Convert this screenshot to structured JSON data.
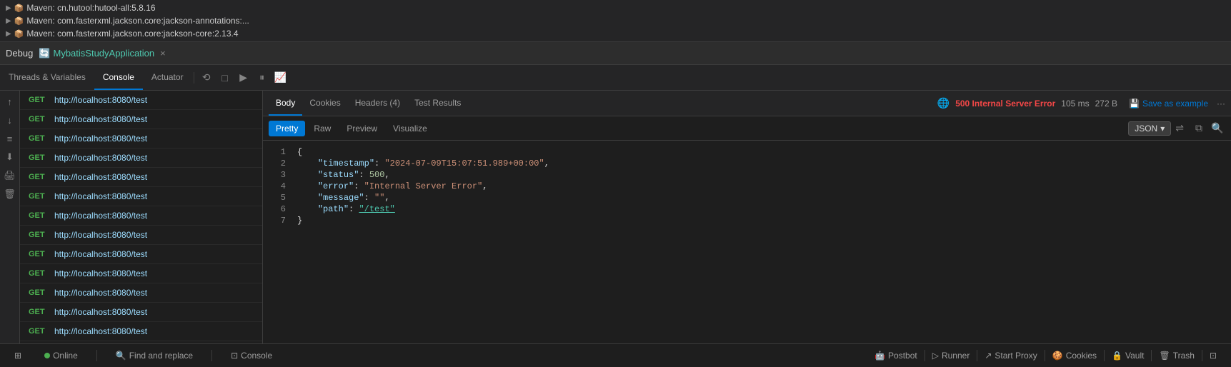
{
  "maven": {
    "items": [
      {
        "label": "Maven: cn.hutool:hutool-all:5.8.16",
        "indent": 1
      },
      {
        "label": "Maven: com.fasterxml.jackson.core:jackson-annotations:...",
        "indent": 1
      },
      {
        "label": "Maven: com.fasterxml.jackson.core:jackson-core:2.13.4",
        "indent": 1
      }
    ]
  },
  "debug": {
    "label": "Debug",
    "app_name": "MybatisStudyApplication",
    "close": "×"
  },
  "tabs": {
    "threads_variables": "Threads & Variables",
    "console": "Console",
    "actuator": "Actuator",
    "icons": [
      "⟲",
      "□",
      "▶",
      "⏸",
      "📈"
    ]
  },
  "side_icons": [
    "↑",
    "↓",
    "≡",
    "⬇",
    "🖨",
    "🗑"
  ],
  "requests": [
    {
      "method": "GET",
      "url": "http://localhost:8080/test"
    },
    {
      "method": "GET",
      "url": "http://localhost:8080/test"
    },
    {
      "method": "GET",
      "url": "http://localhost:8080/test"
    },
    {
      "method": "GET",
      "url": "http://localhost:8080/test"
    },
    {
      "method": "GET",
      "url": "http://localhost:8080/test"
    },
    {
      "method": "GET",
      "url": "http://localhost:8080/test"
    },
    {
      "method": "GET",
      "url": "http://localhost:8080/test"
    },
    {
      "method": "GET",
      "url": "http://localhost:8080/test"
    },
    {
      "method": "GET",
      "url": "http://localhost:8080/test"
    },
    {
      "method": "GET",
      "url": "http://localhost:8080/test"
    },
    {
      "method": "GET",
      "url": "http://localhost:8080/test"
    },
    {
      "method": "GET",
      "url": "http://localhost:8080/test"
    },
    {
      "method": "GET",
      "url": "http://localhost:8080/test"
    }
  ],
  "response": {
    "tabs": [
      "Body",
      "Cookies",
      "Headers (4)",
      "Test Results"
    ],
    "active_tab": "Body",
    "status_code": "500 Internal Server Error",
    "time": "105 ms",
    "size": "272 B",
    "save_example": "Save as example",
    "more": "···",
    "body_tabs": [
      "Pretty",
      "Raw",
      "Preview",
      "Visualize"
    ],
    "active_body_tab": "Pretty",
    "format": "JSON",
    "lines": [
      {
        "num": 1,
        "content": "{"
      },
      {
        "num": 2,
        "key": "\"timestamp\"",
        "value": "\"2024-07-09T15:07:51.989+00:00\"",
        "comma": true
      },
      {
        "num": 3,
        "key": "\"status\"",
        "value": "500",
        "comma": true
      },
      {
        "num": 4,
        "key": "\"error\"",
        "value": "\"Internal Server Error\"",
        "comma": true
      },
      {
        "num": 5,
        "key": "\"message\"",
        "value": "\"\"",
        "comma": true
      },
      {
        "num": 6,
        "key": "\"path\"",
        "value": "\"/test\"",
        "link": true,
        "comma": false
      },
      {
        "num": 7,
        "content": "}"
      }
    ]
  },
  "status_bar": {
    "toggle_label": "⊞",
    "online": "Online",
    "find_replace": "Find and replace",
    "console": "Console",
    "postbot": "Postbot",
    "runner": "Runner",
    "start_proxy": "Start Proxy",
    "cookies": "Cookies",
    "vault": "Vault",
    "trash": "Trash",
    "expand": "⊡"
  }
}
